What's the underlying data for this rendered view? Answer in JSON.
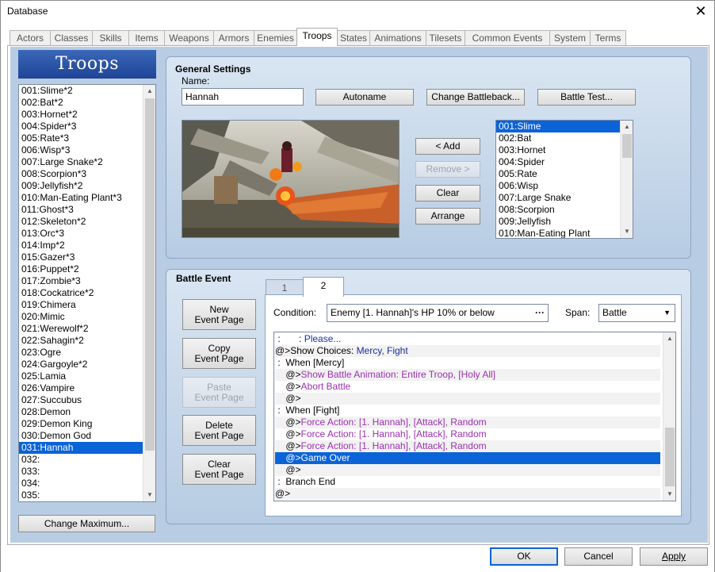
{
  "window": {
    "title": "Database",
    "close_glyph": "✕"
  },
  "tabs": [
    "Actors",
    "Classes",
    "Skills",
    "Items",
    "Weapons",
    "Armors",
    "Enemies",
    "Troops",
    "States",
    "Animations",
    "Tilesets",
    "Common Events",
    "System",
    "Terms"
  ],
  "troops_header": "Troops",
  "troop_list": [
    "001:Slime*2",
    "002:Bat*2",
    "003:Hornet*2",
    "004:Spider*3",
    "005:Rate*3",
    "006:Wisp*3",
    "007:Large Snake*2",
    "008:Scorpion*3",
    "009:Jellyfish*2",
    "010:Man-Eating Plant*3",
    "011:Ghost*3",
    "012:Skeleton*2",
    "013:Orc*3",
    "014:Imp*2",
    "015:Gazer*3",
    "016:Puppet*2",
    "017:Zombie*3",
    "018:Cockatrice*2",
    "019:Chimera",
    "020:Mimic",
    "021:Werewolf*2",
    "022:Sahagin*2",
    "023:Ogre",
    "024:Gargoyle*2",
    "025:Lamia",
    "026:Vampire",
    "027:Succubus",
    "028:Demon",
    "029:Demon King",
    "030:Demon God",
    "031:Hannah",
    "032:",
    "033:",
    "034:",
    "035:"
  ],
  "troop_selected": "031:Hannah",
  "change_max": "Change Maximum...",
  "general": {
    "title": "General Settings",
    "name_label": "Name:",
    "name_value": "Hannah",
    "autoname": "Autoname",
    "change_bb": "Change Battleback...",
    "battle_test": "Battle Test..."
  },
  "members": {
    "add": "< Add",
    "remove": "Remove >",
    "clear": "Clear",
    "arrange": "Arrange"
  },
  "enemy_list": [
    "001:Slime",
    "002:Bat",
    "003:Hornet",
    "004:Spider",
    "005:Rate",
    "006:Wisp",
    "007:Large Snake",
    "008:Scorpion",
    "009:Jellyfish",
    "010:Man-Eating Plant"
  ],
  "enemy_selected": "001:Slime",
  "battle_event": {
    "title": "Battle Event",
    "pages": [
      "1",
      "2"
    ],
    "active_page": "2",
    "new_page": [
      "New",
      "Event Page"
    ],
    "copy_page": [
      "Copy",
      "Event Page"
    ],
    "paste_page": [
      "Paste",
      "Event Page"
    ],
    "delete_page": [
      "Delete",
      "Event Page"
    ],
    "clear_page": [
      "Clear",
      "Event Page"
    ],
    "condition_label": "Condition:",
    "condition_value": "Enemy [1. Hannah]'s HP 10% or below",
    "condition_btn": "···",
    "span_label": "Span:",
    "span_value": "Battle"
  },
  "commands": [
    {
      "prefix": " :       : ",
      "text": "Please...",
      "color": "navy"
    },
    {
      "prefix": "@>Show Choices: ",
      "text": "Mercy, Fight",
      "color": "navy"
    },
    {
      "prefix": " :  When [Mercy]",
      "text": "",
      "color": ""
    },
    {
      "prefix": "    @>",
      "text": "Show Battle Animation: Entire Troop, [Holy All]",
      "color": "pur"
    },
    {
      "prefix": "    @>",
      "text": "Abort Battle",
      "color": "pur"
    },
    {
      "prefix": "    @>",
      "text": "",
      "color": ""
    },
    {
      "prefix": " :  When [Fight]",
      "text": "",
      "color": ""
    },
    {
      "prefix": "    @>",
      "text": "Force Action: [1. Hannah], [Attack], Random",
      "color": "pur"
    },
    {
      "prefix": "    @>",
      "text": "Force Action: [1. Hannah], [Attack], Random",
      "color": "pur"
    },
    {
      "prefix": "    @>",
      "text": "Force Action: [1. Hannah], [Attack], Random",
      "color": "pur"
    },
    {
      "prefix": "    @>",
      "text": "Game Over",
      "color": "sel"
    },
    {
      "prefix": "    @>",
      "text": "",
      "color": ""
    },
    {
      "prefix": " :  Branch End",
      "text": "",
      "color": ""
    },
    {
      "prefix": "@>",
      "text": "",
      "color": ""
    }
  ],
  "footer": {
    "ok": "OK",
    "cancel": "Cancel",
    "apply": "Apply"
  },
  "colors": {
    "accent": "#0b63d8",
    "panel": "#b8cde4",
    "purple": "#9b30b0",
    "navy": "#1d2f9c"
  }
}
